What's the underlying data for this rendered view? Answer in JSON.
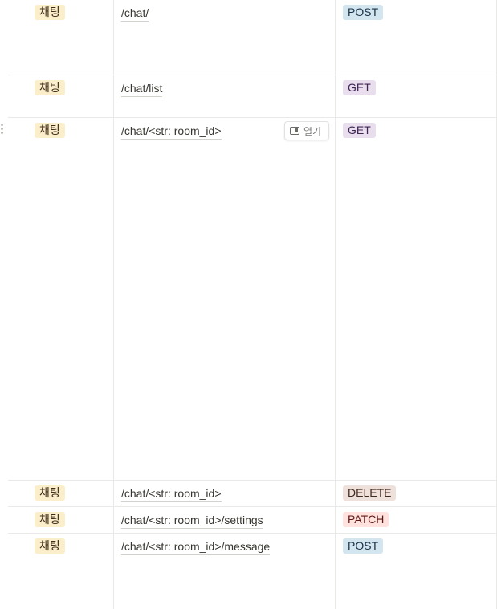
{
  "colors": {
    "category_bg": "#fbeeca",
    "category_fg": "#402c1b",
    "method_POST_bg": "#d3e5ef",
    "method_POST_fg": "#183347",
    "method_GET_bg": "#e8deee",
    "method_GET_fg": "#412454",
    "method_DELETE_bg": "#eee0da",
    "method_DELETE_fg": "#442a1e",
    "method_PATCH_bg": "#ffe2dd",
    "method_PATCH_fg": "#5d1715"
  },
  "rows": [
    {
      "category": "채팅",
      "route": "/chat/",
      "method": "POST"
    },
    {
      "category": "채팅",
      "route": "/chat/list",
      "method": "GET"
    },
    {
      "category": "채팅",
      "route": "/chat/<str: room_id>",
      "method": "GET",
      "open_label": "열기"
    },
    {
      "category": "채팅",
      "route": "/chat/<str: room_id>",
      "method": "DELETE"
    },
    {
      "category": "채팅",
      "route": "/chat/<str: room_id>/settings",
      "method": "PATCH"
    },
    {
      "category": "채팅",
      "route": "/chat/<str: room_id>/message",
      "method": "POST"
    }
  ]
}
